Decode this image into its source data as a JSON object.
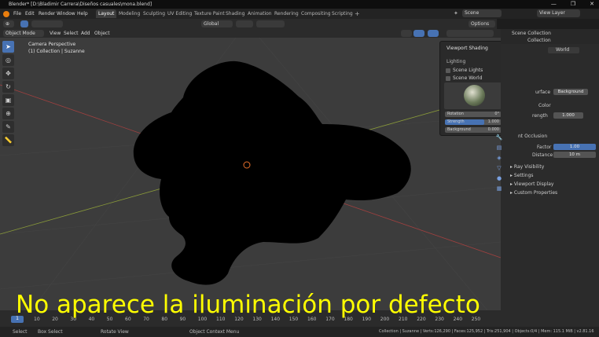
{
  "window": {
    "title": "Blender* [D:\\Bladimir Carrera\\Diseños casuales\\mona.blend]",
    "controls": [
      "—",
      "❐",
      "✕"
    ]
  },
  "menu": [
    "File",
    "Edit",
    "Render",
    "Window",
    "Help"
  ],
  "workspaces": [
    "Layout",
    "Modeling",
    "Sculpting",
    "UV Editing",
    "Texture Paint",
    "Shading",
    "Animation",
    "Rendering",
    "Compositing",
    "Scripting"
  ],
  "scene": "Scene",
  "view_layer": "View Layer",
  "header": {
    "transform": "Global",
    "options": "Options"
  },
  "viewport_header": {
    "mode": "Object Mode",
    "menus": [
      "View",
      "Select",
      "Add",
      "Object"
    ]
  },
  "viewport_info": {
    "line1": "Camera Perspective",
    "line2": "(1) Collection | Suzanne"
  },
  "shading_popover": {
    "title": "Viewport Shading",
    "section": "Lighting",
    "scene_lights": "Scene Lights",
    "scene_world": "Scene World",
    "rotation_label": "Rotation",
    "rotation_value": "0°",
    "strength_label": "Strength",
    "strength_value": "1.000",
    "strength_fraction": 0.7,
    "background_label": "Background",
    "background_value": "0.000"
  },
  "outliner": {
    "scene_collection": "Scene Collection",
    "collection": "Collection"
  },
  "properties": {
    "world_name": "World",
    "surface_label": "urface",
    "surface_value": "Background",
    "color_label": "Color",
    "strength_label": "rength",
    "strength_value": "1.000",
    "ao_label": "nt Occlusion",
    "factor_label": "Factor",
    "factor_value": "1.00",
    "distance_label": "Distance",
    "distance_value": "10 m",
    "panels": [
      "Ray Visibility",
      "Settings",
      "Viewport Display",
      "Custom Properties"
    ]
  },
  "timeline": {
    "current_frame": "1",
    "frames": [
      "10",
      "20",
      "30",
      "40",
      "50",
      "60",
      "70",
      "80",
      "90",
      "100",
      "110",
      "120",
      "130",
      "140",
      "150",
      "160",
      "170",
      "180",
      "190",
      "200",
      "210",
      "220",
      "230",
      "240",
      "250"
    ]
  },
  "statusbar": {
    "select": "Select",
    "box_select": "Box Select",
    "rotate_view": "Rotate View",
    "context_menu": "Object Context Menu",
    "stats": "Collection | Suzanne | Verts:126,290 | Faces:125,952 | Tris:251,904 | Objects:0/4 | Mem: 115.1 MiB | v2.81.16"
  },
  "caption": "No aparece la iluminación por defecto",
  "colors": {
    "accent": "#4772b3",
    "caption": "#ffff00",
    "logo": "#e87d0d",
    "origin": "#e8702a"
  }
}
